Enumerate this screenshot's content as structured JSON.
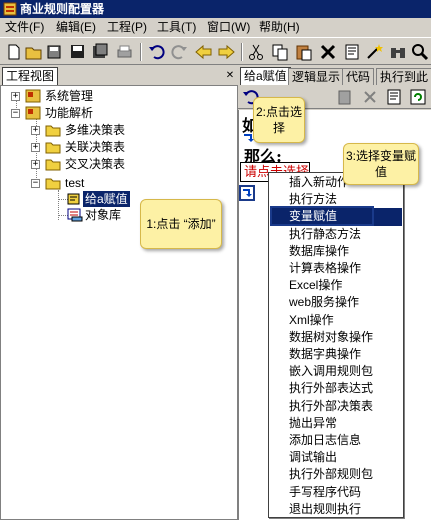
{
  "window": {
    "title": "商业规则配置器"
  },
  "menu": [
    "文件(F)",
    "编辑(E)",
    "工程(P)",
    "工具(T)",
    "窗口(W)",
    "帮助(H)"
  ],
  "toolbar_icons": [
    "new-icon",
    "open-icon",
    "save-icon",
    "save-all-icon",
    "save-as-icon",
    "print-icon",
    "undo-icon",
    "redo-icon",
    "back-icon",
    "forward-icon",
    "cut-icon",
    "copy-icon",
    "paste-icon",
    "delete-icon",
    "properties-icon",
    "wand-icon",
    "binoculars-icon",
    "find-icon"
  ],
  "left_panel": {
    "tab": "工程视图",
    "tree": {
      "system": "系统管理",
      "function": "功能解析",
      "multi": "多维决策表",
      "related": "关联决策表",
      "cross": "交叉决策表",
      "test": "test",
      "assign": "给a赋值",
      "objects": "对象库"
    }
  },
  "right_panel": {
    "tabs": [
      "给a赋值",
      "逻辑显示",
      "代码",
      "执行到此"
    ],
    "content": {
      "if_text": "如",
      "then_text": "那么:",
      "placeholder": "请点击选择"
    }
  },
  "context_menu": {
    "items": [
      "插入新动作",
      "执行方法",
      "变量赋值",
      "执行静态方法",
      "数据库操作",
      "计算表格操作",
      "Excel操作",
      "web服务操作",
      "Xml操作",
      "数据树对象操作",
      "数据字典操作",
      "嵌入调用规则包",
      "执行外部表达式",
      "执行外部决策表",
      "抛出异常",
      "添加日志信息",
      "调试输出",
      "执行外部规则包",
      "手写程序代码",
      "退出规则执行"
    ],
    "highlighted_index": 2
  },
  "annotations": {
    "step1": "1:点击 “添加”",
    "step2": "2:点击选择",
    "step3": "3:选择变量赋值"
  },
  "colors": {
    "titlebar": "#0a246a",
    "highlight": "#0a246a",
    "callout": "#fdf1a5",
    "placeholder_text": "#cc0000"
  }
}
